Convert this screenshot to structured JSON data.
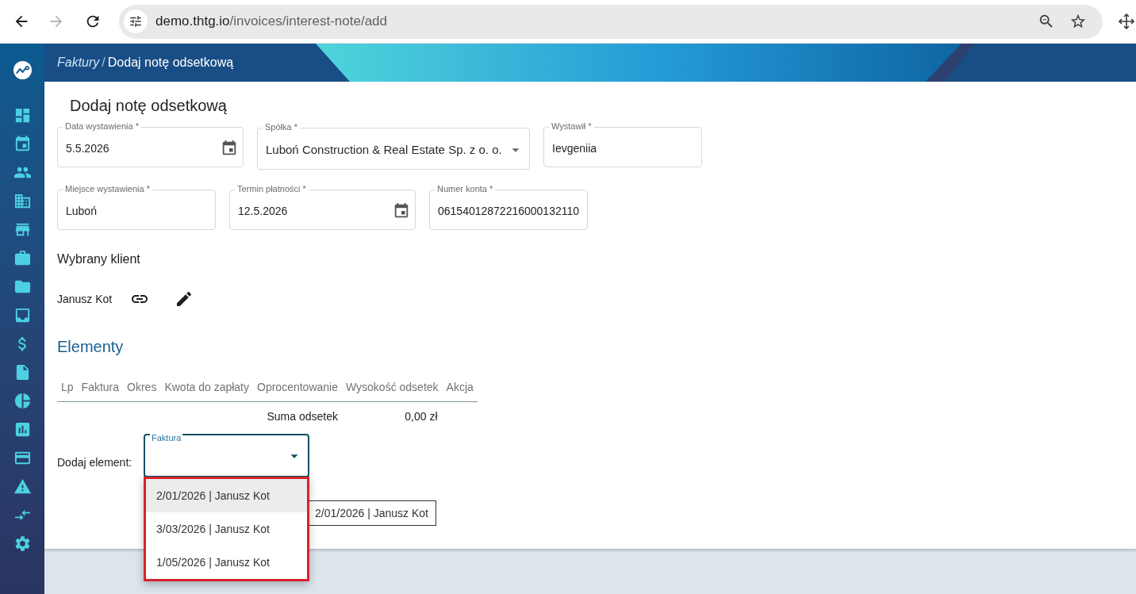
{
  "browser": {
    "back": {
      "disabled": false
    },
    "forward": {
      "disabled": true
    },
    "url": {
      "host": "demo.thtg.io",
      "path": "/invoices/interest-note/add"
    }
  },
  "header": {
    "breadcrumb": [
      {
        "label": "Faktury",
        "kind": "link"
      },
      {
        "label": "Dodaj notę odsetkową",
        "kind": "current"
      }
    ],
    "separator": "/"
  },
  "page": {
    "title": "Dodaj notę odsetkową"
  },
  "field_rows": [
    [
      {
        "kind": "date",
        "label": "Data wystawienia *",
        "value": "5.5.2026"
      },
      {
        "kind": "select",
        "label": "Spółka *",
        "value": "Luboń Construction & Real Estate Sp. z o. o."
      },
      {
        "kind": "text",
        "label": "Wystawił *",
        "value": "Ievgeniia"
      }
    ],
    [
      {
        "kind": "text",
        "label": "Miejsce wystawienia *",
        "value": "Luboń"
      },
      {
        "kind": "date",
        "label": "Termin płatności *",
        "value": "12.5.2026"
      },
      {
        "kind": "text",
        "label": "Numer konta *",
        "value": "06154012872216000132110"
      }
    ]
  ],
  "client": {
    "heading": "Wybrany klient",
    "name": "Janusz Kot"
  },
  "elements": {
    "heading": "Elementy",
    "columns": [
      "Lp",
      "Faktura",
      "Okres",
      "Kwota do zapłaty",
      "Oprocentowanie",
      "Wysokość odsetek",
      "Akcja"
    ],
    "total": {
      "label": "Suma odsetek",
      "value": "0,00 zł"
    }
  },
  "add_element": {
    "label": "Dodaj element:",
    "select": {
      "label": "Faktura",
      "focused": true,
      "expanded": true,
      "options": [
        {
          "label": "2/01/2026 | Janusz Kot",
          "highlighted": true,
          "selected": false
        },
        {
          "label": "3/03/2026 | Janusz Kot",
          "highlighted": false,
          "selected": false
        },
        {
          "label": "1/05/2026 | Janusz Kot",
          "highlighted": false,
          "selected": false
        }
      ]
    },
    "tooltip": "2/01/2026 | Janusz Kot"
  }
}
